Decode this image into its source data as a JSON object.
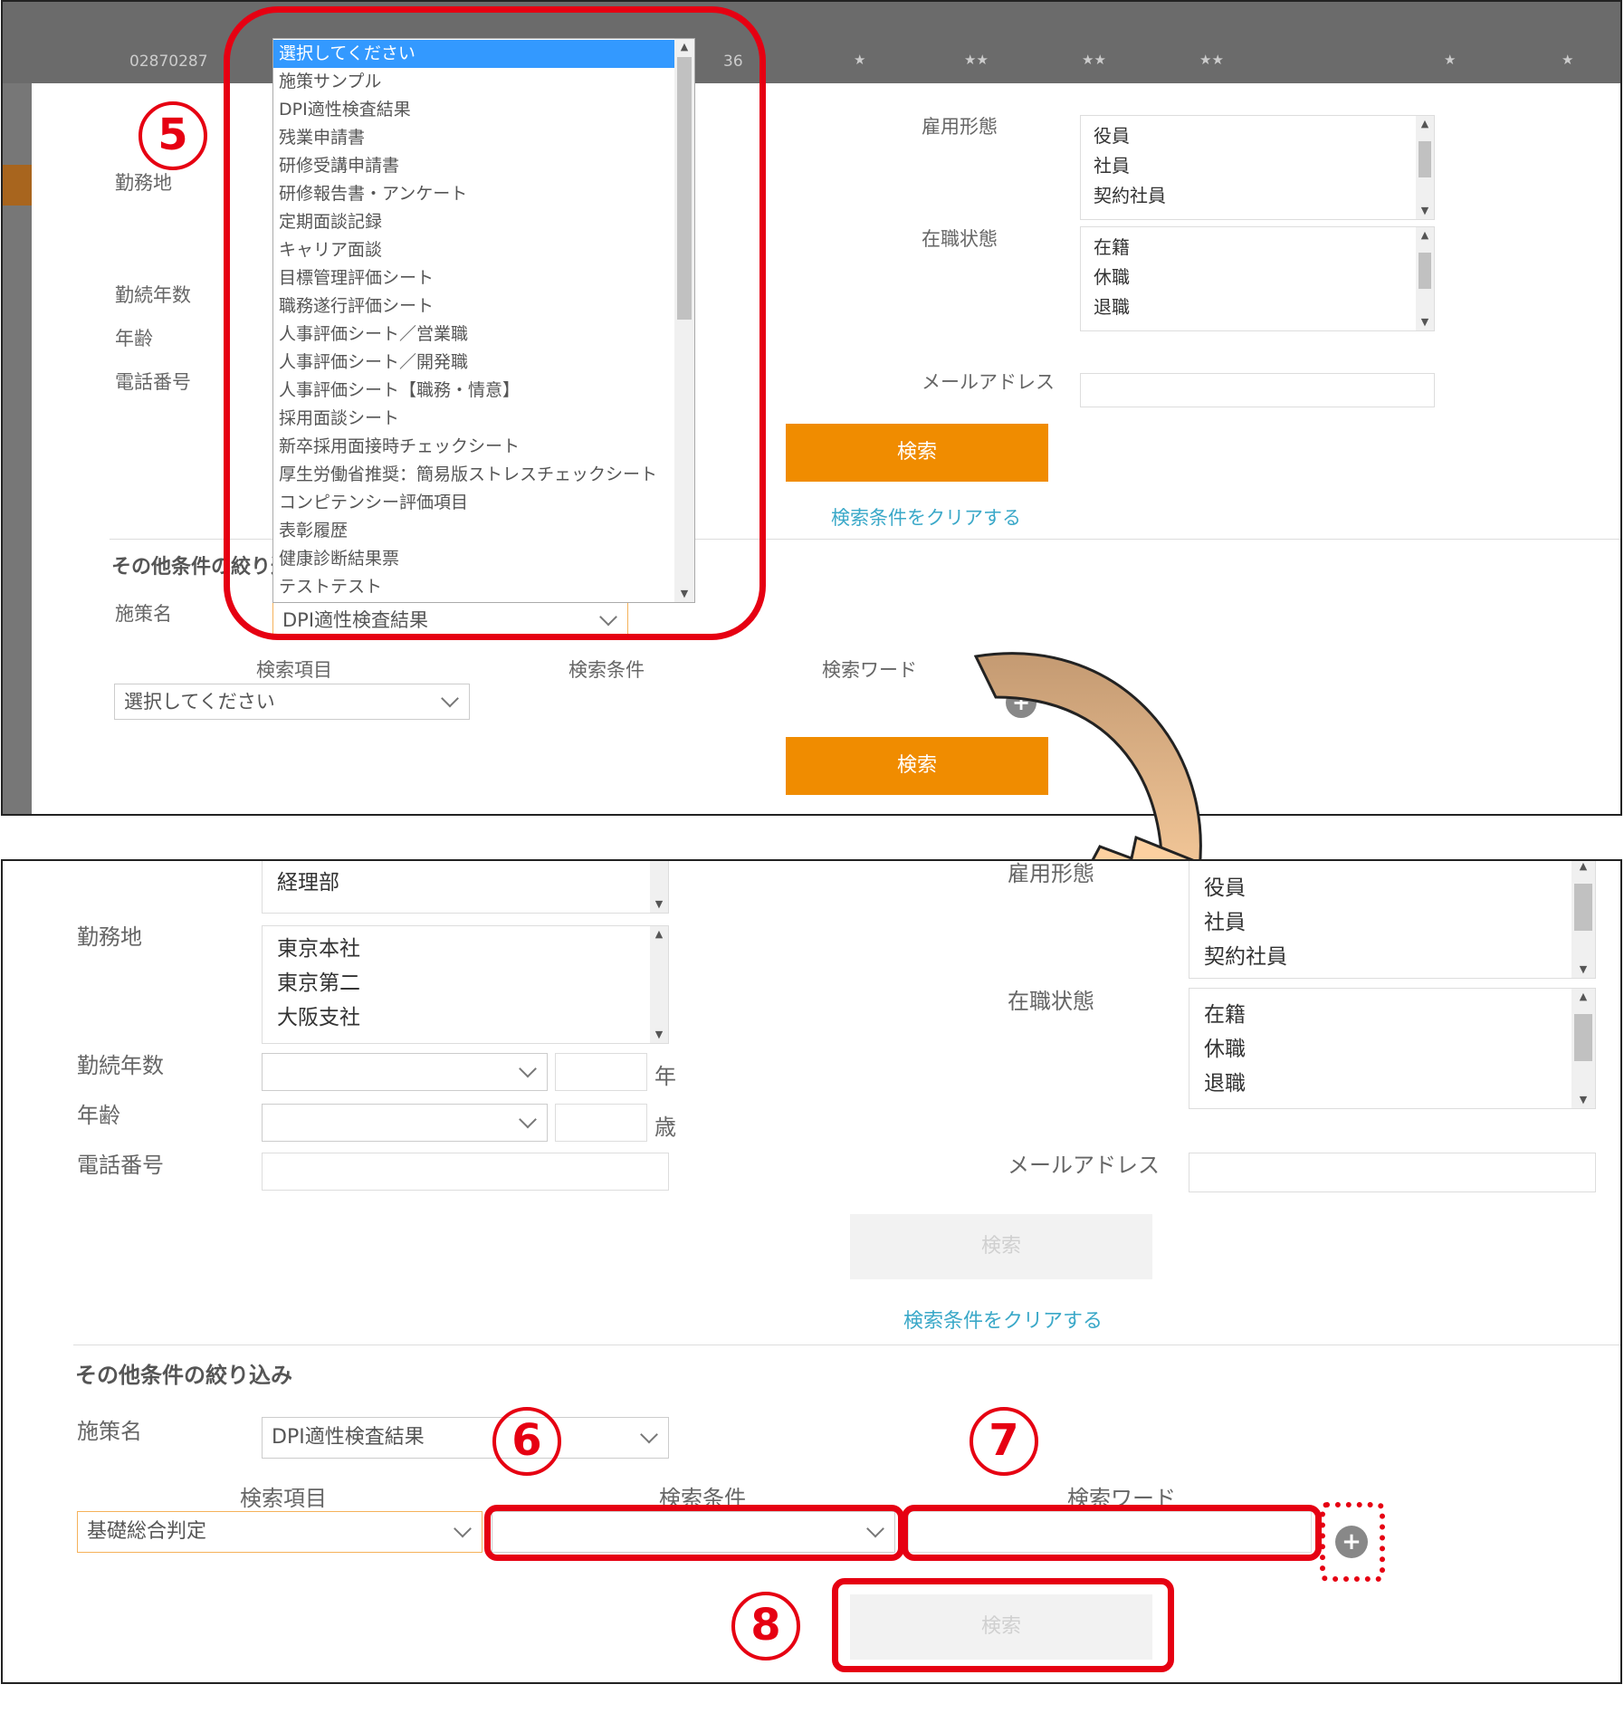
{
  "top": {
    "header_row_id": "02870287",
    "header_row_num": "36",
    "header_stars": [
      "★",
      "★★",
      "★★",
      "★★",
      "★",
      "★"
    ],
    "labels": {
      "workplace": "勤務地",
      "years": "勤続年数",
      "age": "年齢",
      "phone": "電話番号",
      "employment_type": "雇用形態",
      "status": "在職状態",
      "email": "メールアドレス",
      "other_conditions": "その他条件の絞り込み",
      "measure_name": "施策名",
      "search_item": "検索項目",
      "search_condition": "検索条件",
      "search_word": "検索ワード"
    },
    "employment_items": [
      "役員",
      "社員",
      "契約社員"
    ],
    "status_items": [
      "在籍",
      "休職",
      "退職"
    ],
    "search_button": "検索",
    "clear_link": "検索条件をクリアする",
    "measure_value": "DPI適性検査結果",
    "search_item_placeholder": "選択してください",
    "search_button2": "検索",
    "dropdown_items": [
      "選択してください",
      "施策サンプル",
      "DPI適性検査結果",
      "残業申請書",
      "研修受講申請書",
      "研修報告書・アンケート",
      "定期面談記録",
      "キャリア面談",
      "目標管理評価シート",
      "職務遂行評価シート",
      "人事評価シート／営業職",
      "人事評価シート／開発職",
      "人事評価シート【職務・情意】",
      "採用面談シート",
      "新卒採用面接時チェックシート",
      "厚生労働省推奨：簡易版ストレスチェックシート",
      "コンピテンシー評価項目",
      "表彰履歴",
      "健康診断結果票",
      "テストテスト"
    ]
  },
  "bottom": {
    "labels": {
      "workplace": "勤務地",
      "years": "勤続年数",
      "age": "年齢",
      "phone": "電話番号",
      "employment_type": "雇用形態",
      "status": "在職状態",
      "email": "メールアドレス",
      "other_conditions": "その他条件の絞り込み",
      "measure_name": "施策名",
      "search_item": "検索項目",
      "search_condition": "検索条件",
      "search_word": "検索ワード",
      "year_unit": "年",
      "age_unit": "歳"
    },
    "department_item": "経理部",
    "workplace_items": [
      "東京本社",
      "東京第二",
      "大阪支社"
    ],
    "employment_items": [
      "役員",
      "社員",
      "契約社員"
    ],
    "status_items": [
      "在籍",
      "休職",
      "退職"
    ],
    "search_button": "検索",
    "clear_link": "検索条件をクリアする",
    "measure_value": "DPI適性検査結果",
    "search_item_value": "基礎総合判定",
    "search_button2": "検索"
  },
  "annotations": {
    "step5": "5",
    "step6": "6",
    "step7": "7",
    "step8": "8"
  },
  "colors": {
    "accent_orange": "#f08c00",
    "highlight_red": "#e60012",
    "link_blue": "#3aa8c8",
    "arrow_fill": "#d9a877"
  }
}
